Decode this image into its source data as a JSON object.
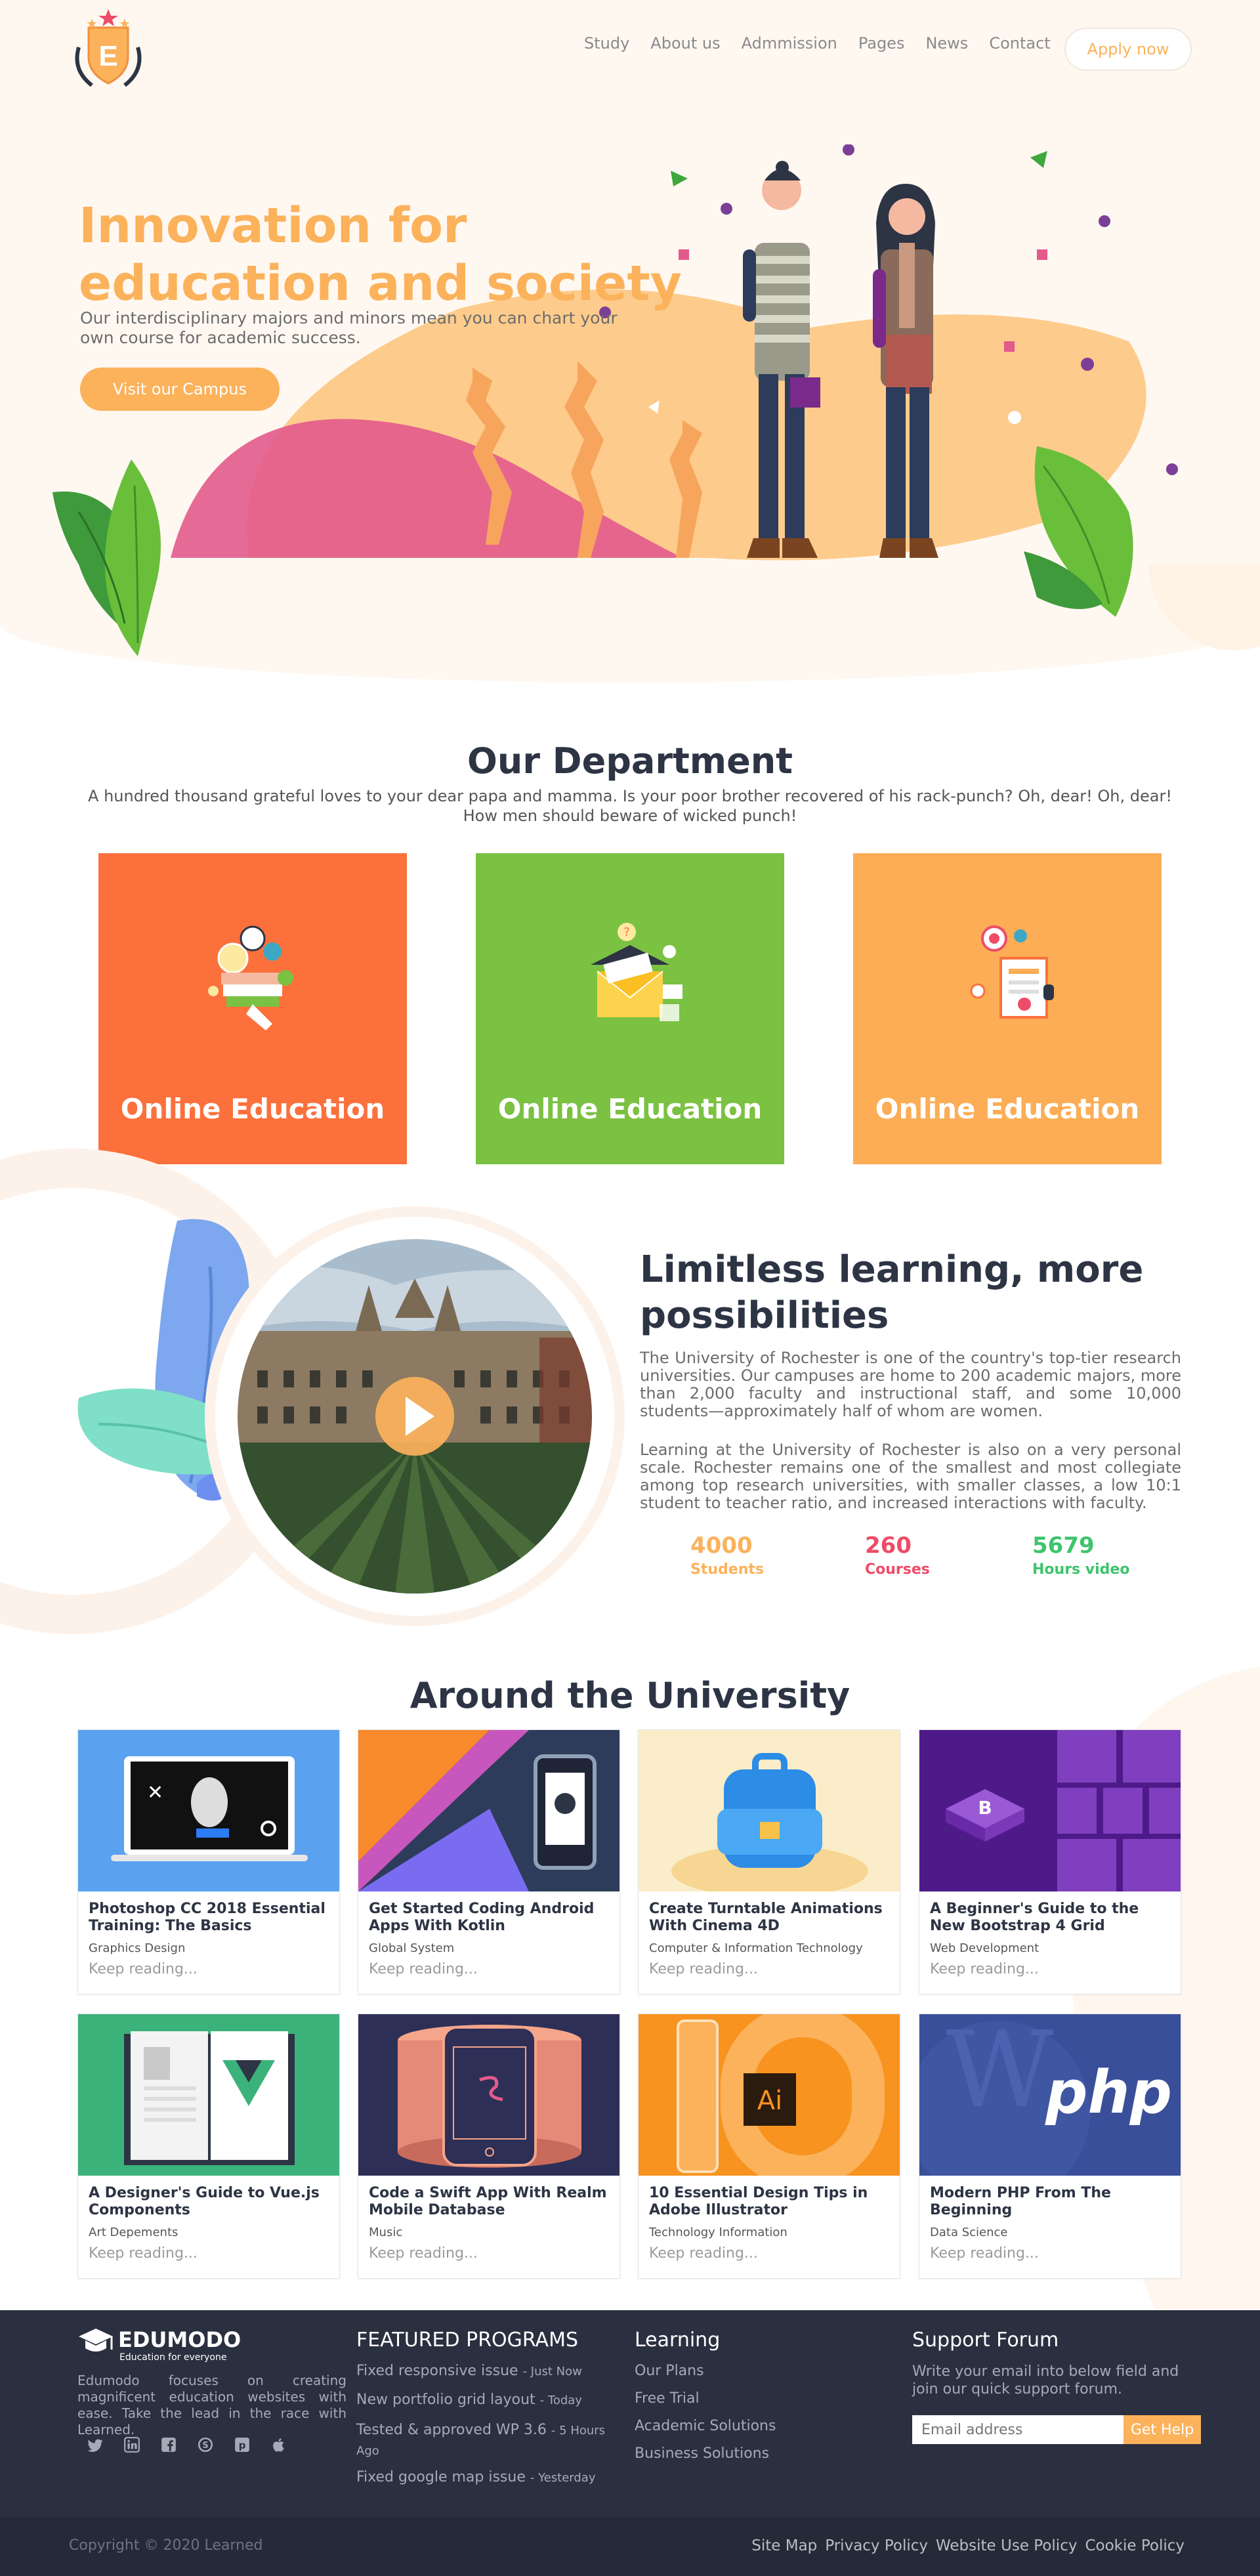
{
  "header": {
    "logo_letter": "E",
    "nav": [
      "Study",
      "About us",
      "Admmission",
      "Pages",
      "News",
      "Contact"
    ],
    "apply_label": "Apply now"
  },
  "hero": {
    "title": "Innovation for education and society",
    "subtitle": "Our interdisciplinary majors and minors mean you can chart your own course for academic success.",
    "button": "Visit our Campus"
  },
  "department": {
    "title": "Our Department",
    "subtitle": "A hundred thousand grateful loves to your dear papa and mamma. Is your poor brother recovered of his rack-punch? Oh, dear! Oh, dear! How men should beware of wicked punch!",
    "cards": [
      {
        "label": "Online Education",
        "color": "#fc703c"
      },
      {
        "label": "Online Education",
        "color": "#7bc142"
      },
      {
        "label": "Online Education",
        "color": "#fcad55"
      }
    ]
  },
  "limitless": {
    "title": "Limitless learning, more possibilities",
    "p1": "The University of Rochester is one of the country's top-tier research universities. Our campuses are home to 200 academic majors, more than 2,000 faculty and instructional staff, and some 10,000 students—approximately half of whom are women.",
    "p2": "Learning at the University of Rochester is also on a very personal scale. Rochester remains one of the smallest and most collegiate among top research universities, with smaller classes, a low 10:1 student to teacher ratio, and increased interactions with faculty.",
    "stats": [
      {
        "num": "4000",
        "label": "Students",
        "color": "#fbb25b"
      },
      {
        "num": "260",
        "label": "Courses",
        "color": "#ee4c68"
      },
      {
        "num": "5679",
        "label": "Hours video",
        "color": "#3ec46d"
      }
    ]
  },
  "university": {
    "title": "Around the University",
    "keep_reading": "Keep reading...",
    "cards": [
      {
        "title": "Photoshop CC 2018 Essential Training: The Basics",
        "category": "Graphics Design"
      },
      {
        "title": "Get Started Coding Android Apps With Kotlin",
        "category": "Global System"
      },
      {
        "title": "Create Turntable Animations With Cinema 4D",
        "category": "Computer & Information Technology"
      },
      {
        "title": "A Beginner's Guide to the New Bootstrap 4 Grid",
        "category": "Web Development"
      },
      {
        "title": "A Designer's Guide to Vue.js Components",
        "category": "Art Depements"
      },
      {
        "title": "Code a Swift App With Realm Mobile Database",
        "category": "Music"
      },
      {
        "title": "10 Essential Design Tips in Adobe Illustrator",
        "category": "Technology Information"
      },
      {
        "title": "Modern PHP From The Beginning",
        "category": "Data Science"
      }
    ]
  },
  "footer": {
    "brand": "EDUMODO",
    "tagline": "Education for everyone",
    "about": "Edumodo focuses on creating magnificent education websites with ease. Take the lead in the race with Learned.",
    "featured_title": "FEATURED PROGRAMS",
    "featured": [
      {
        "text": "Fixed responsive issue",
        "time": "- Just Now"
      },
      {
        "text": "New portfolio grid layout",
        "time": "- Today"
      },
      {
        "text": "Tested & approved WP 3.6",
        "time": "- 5 Hours Ago"
      },
      {
        "text": "Fixed google map issue",
        "time": "- Yesterday"
      }
    ],
    "learning_title": "Learning",
    "learning": [
      "Our Plans",
      "Free Trial",
      "Academic Solutions",
      "Business Solutions"
    ],
    "support_title": "Support Forum",
    "support_text": "Write your email into below field and join our quick support forum.",
    "email_placeholder": "Email address",
    "get_help": "Get Help",
    "copyright": "Copyright © 2020 Learned",
    "links": [
      "Site Map",
      "Privacy Policy",
      "Website Use Policy",
      "Cookie Policy"
    ]
  }
}
